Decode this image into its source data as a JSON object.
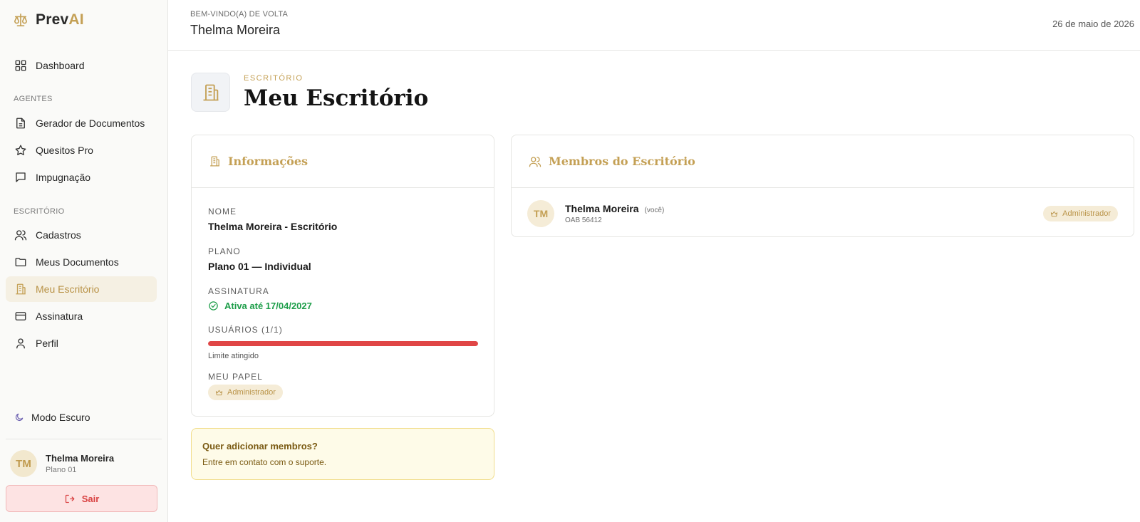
{
  "app": {
    "name_main": "Prev",
    "name_accent": "AI"
  },
  "nav": {
    "dashboard": "Dashboard",
    "section_agents": "AGENTES",
    "agents": [
      "Gerador de Documentos",
      "Quesitos Pro",
      "Impugnação"
    ],
    "section_office": "ESCRITÓRIO",
    "office": [
      "Cadastros",
      "Meus Documentos",
      "Meu Escritório",
      "Assinatura",
      "Perfil"
    ],
    "active": "Meu Escritório"
  },
  "sidebar_footer": {
    "dark_mode": "Modo Escuro",
    "user_initials": "TM",
    "user_name": "Thelma Moreira",
    "user_plan": "Plano 01",
    "logout": "Sair"
  },
  "header": {
    "welcome": "BEM-VINDO(A) DE VOLTA",
    "name": "Thelma Moreira",
    "date": "26 de maio de 2026"
  },
  "page": {
    "eyebrow": "ESCRITÓRIO",
    "title": "Meu Escritório"
  },
  "info": {
    "title": "Informações",
    "name_label": "NOME",
    "name_value": "Thelma Moreira - Escritório",
    "plan_label": "PLANO",
    "plan_value": "Plano 01 — Individual",
    "subscription_label": "ASSINATURA",
    "subscription_value": "Ativa até 17/04/2027",
    "users_label": "USUÁRIOS (1/1)",
    "users_used": 1,
    "users_max": 1,
    "limit_text": "Limite atingido",
    "role_label": "MEU PAPEL",
    "role_value": "Administrador"
  },
  "notice": {
    "title": "Quer adicionar membros?",
    "text": "Entre em contato com o suporte."
  },
  "members": {
    "title": "Membros do Escritório",
    "list": [
      {
        "initials": "TM",
        "name": "Thelma Moreira",
        "you": "(você)",
        "oab": "OAB  56412",
        "role": "Administrador"
      }
    ]
  },
  "colors": {
    "accent": "#c4a055",
    "success": "#1e9e4a",
    "danger": "#e04646"
  }
}
